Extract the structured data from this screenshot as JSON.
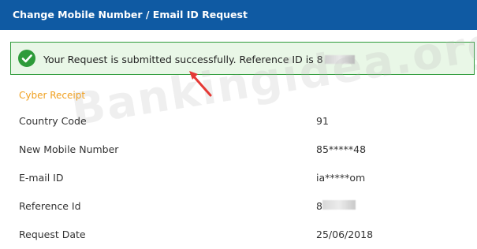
{
  "header": {
    "title": "Change Mobile Number / Email ID Request"
  },
  "success": {
    "message": "Your Request is submitted successfully. Reference ID is 8",
    "icon": "check-circle-icon"
  },
  "watermark": {
    "text": "Bankingidea.org"
  },
  "receipt": {
    "title": "Cyber Receipt",
    "rows": [
      {
        "label": "Country Code",
        "value": "91"
      },
      {
        "label": "New Mobile Number",
        "value": "85*****48"
      },
      {
        "label": "E-mail ID",
        "value": "ia*****om"
      },
      {
        "label": "Reference Id",
        "value": "8"
      },
      {
        "label": "Request Date",
        "value": "25/06/2018"
      }
    ]
  },
  "colors": {
    "header_bg": "#0f5aa3",
    "success_border": "#2e9b3a",
    "success_bg": "#e9f7e7",
    "section_title": "#f0a020"
  }
}
